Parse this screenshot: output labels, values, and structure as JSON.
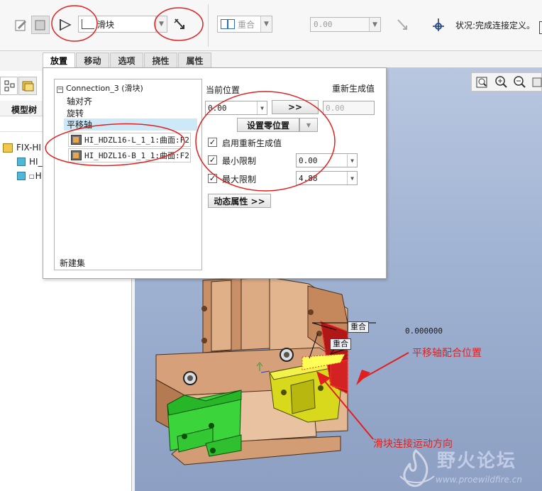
{
  "toolbar": {
    "type_select": "滑块",
    "constraint_select": "重合",
    "offset_value": "0.00",
    "status_text": "状况:完成连接定义。"
  },
  "tabs": [
    {
      "label": "放置",
      "active": true
    },
    {
      "label": "移动",
      "active": false
    },
    {
      "label": "选项",
      "active": false
    },
    {
      "label": "挠性",
      "active": false
    },
    {
      "label": "属性",
      "active": false
    }
  ],
  "model_tree": {
    "title": "模型树",
    "items": [
      "FIX-HI",
      "HI_",
      "H"
    ]
  },
  "placement": {
    "connection_title": "Connection_3 (滑块)",
    "sets": [
      "轴对齐",
      "旋转",
      "平移轴"
    ],
    "references": [
      "HI_HDZL16-L_1_1:曲面:F2(",
      "HI_HDZL16-B_1_1:曲面:F2("
    ],
    "new_set": "新建集",
    "current_pos_label": "当前位置",
    "regen_label": "重新生成值",
    "current_pos_value": "0.00",
    "arrow_button": ">>",
    "regen_value": "0.00",
    "set_zero_button": "设置零位置",
    "enable_regen_label": "启用重新生成值",
    "min_limit_label": "最小限制",
    "min_limit_value": "0.00",
    "max_limit_label": "最大限制",
    "max_limit_value": "4.88",
    "dynamic_props_button": "动态属性 >>"
  },
  "viewport": {
    "tag1": "重合",
    "tag2": "重合",
    "dim_value": "0.000000",
    "annotation_right": "平移轴配合位置",
    "annotation_bottom": "滑块连接运动方向",
    "watermark_cn": "野火论坛",
    "watermark_url": "www.proewildfire.cn"
  },
  "colors": {
    "annotation_red": "#e02020",
    "viewport_bg": "#a3b5d4",
    "part_tan": "#d8a27a",
    "part_green": "#2fd12f",
    "part_yellow": "#d6d61a"
  }
}
